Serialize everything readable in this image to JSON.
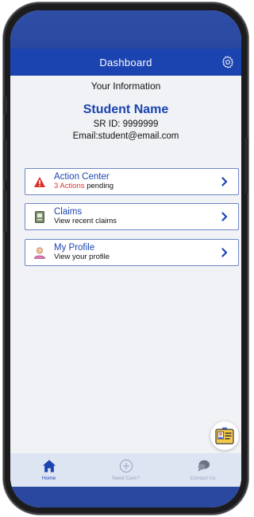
{
  "header": {
    "title": "Dashboard"
  },
  "info": {
    "section_label": "Your Information",
    "name": "Student Name",
    "sr_id": "SR ID: 9999999",
    "email": "Email:student@email.com"
  },
  "cards": [
    {
      "title": "Action Center",
      "sub_accent": "3 Actions",
      "sub_rest": " pending",
      "icon": "warning-icon"
    },
    {
      "title": "Claims",
      "sub": "View recent claims",
      "icon": "claims-card-icon"
    },
    {
      "title": "My Profile",
      "sub": "View your profile",
      "icon": "profile-person-icon"
    }
  ],
  "nav": {
    "home": "Home",
    "need_care": "Need Care?",
    "contact": "Contact Us"
  },
  "colors": {
    "primary": "#1c44b0",
    "accent_red": "#e0322d",
    "background": "#f0f2f5",
    "nav_background": "#dde4f2"
  }
}
